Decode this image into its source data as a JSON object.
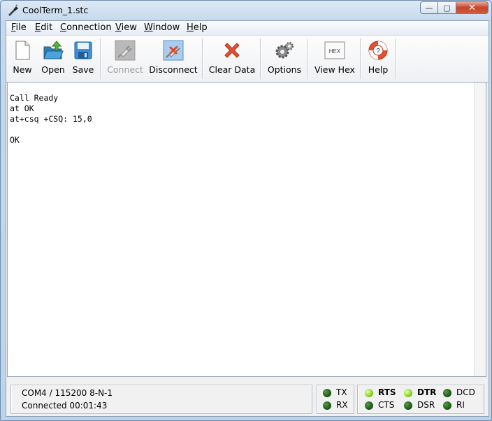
{
  "window": {
    "title": "CoolTerm_1.stc",
    "app_icon": "coolterm-app-icon"
  },
  "caption_buttons": {
    "minimize": "minimize-icon",
    "maximize": "maximize-icon",
    "close": "close-icon"
  },
  "menu": [
    {
      "label": "File",
      "u": "F",
      "rest": "ile"
    },
    {
      "label": "Edit",
      "u": "E",
      "rest": "dit"
    },
    {
      "label": "Connection",
      "u": "C",
      "rest": "onnection"
    },
    {
      "label": "View",
      "u": "V",
      "rest": "iew"
    },
    {
      "label": "Window",
      "u": "W",
      "rest": "indow"
    },
    {
      "label": "Help",
      "u": "H",
      "rest": "elp"
    }
  ],
  "toolbar": {
    "new": "New",
    "open": "Open",
    "save": "Save",
    "connect": "Connect",
    "disconnect": "Disconnect",
    "clear_data": "Clear Data",
    "options": "Options",
    "view_hex": "View Hex",
    "hex_icon_text": "HEX",
    "help": "Help"
  },
  "terminal": {
    "lines": [
      "",
      "Call Ready",
      "at OK",
      "at+csq +CSQ: 15,0",
      "",
      "OK"
    ]
  },
  "status": {
    "port": "COM4 / 115200 8-N-1",
    "connected": "Connected 00:01:43",
    "signals": {
      "tx": {
        "label": "TX",
        "active": false
      },
      "rx": {
        "label": "RX",
        "active": false
      },
      "rts": {
        "label": "RTS",
        "active": true
      },
      "cts": {
        "label": "CTS",
        "active": false
      },
      "dtr": {
        "label": "DTR",
        "active": true
      },
      "dsr": {
        "label": "DSR",
        "active": false
      },
      "dcd": {
        "label": "DCD",
        "active": false
      },
      "ri": {
        "label": "RI",
        "active": false
      }
    }
  },
  "colors": {
    "led_on": "#8fd62a",
    "led_off": "#1e5a18",
    "close_button": "#c7442a"
  }
}
